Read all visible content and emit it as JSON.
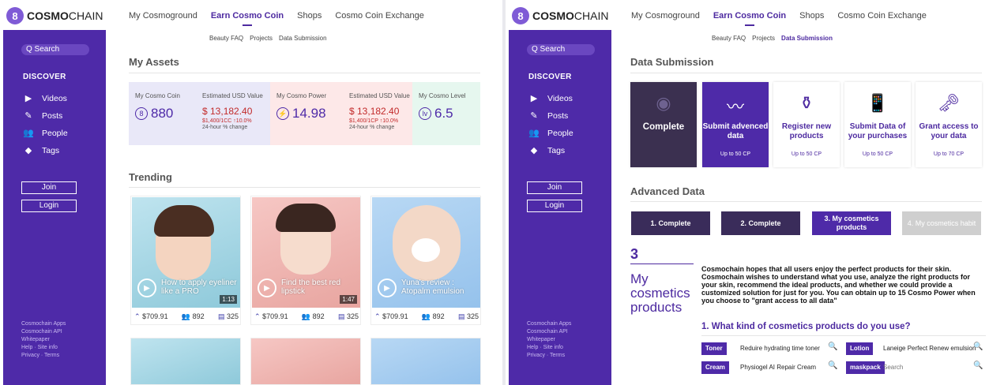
{
  "brand": {
    "logo_part1": "COSMO",
    "logo_part2": "CHAIN",
    "logo_mark": "8"
  },
  "nav": [
    "My Cosmoground",
    "Earn Cosmo Coin",
    "Shops",
    "Cosmo Coin Exchange"
  ],
  "subnav": [
    "Beauty FAQ",
    "Projects",
    "Data Submission"
  ],
  "sidebar": {
    "search": "Q  Search",
    "discover": "DISCOVER",
    "items": [
      {
        "label": "Videos",
        "icon": "video-icon"
      },
      {
        "label": "Posts",
        "icon": "pen-icon"
      },
      {
        "label": "People",
        "icon": "people-icon"
      },
      {
        "label": "Tags",
        "icon": "tag-icon"
      }
    ],
    "join": "Join",
    "login": "Login",
    "footer": [
      "Cosmochain Apps",
      "Cosmochain API",
      "Whitepaper",
      "Help · Site info",
      "Privacy · Terms"
    ]
  },
  "assets": {
    "title": "My Assets",
    "coin_label": "My Cosmo Coin",
    "coin_value": "880",
    "usd_label": "Estimated USD Value",
    "usd_value": "$ 13,182.40",
    "rate1": "$1,400/1CC  ↑10.0%",
    "change": "24-hour % change",
    "power_label": "My Cosmo Power",
    "power_value": "14.98",
    "usd2_label": "Estimated USD Value",
    "usd2_value": "$ 13,182.40",
    "rate2": "$1,400/1CP  ↑10.0%",
    "change2": "24-hour % change",
    "level_label": "My Cosmo Level",
    "level_value": "6.5"
  },
  "trending": {
    "title": "Trending",
    "cards": [
      {
        "title": "How to apply eyeliner like a PRO",
        "duration": "1:13",
        "coin": "$709.91",
        "people": "892",
        "comments": "325"
      },
      {
        "title": "Find the best red lipstick",
        "duration": "1:47",
        "coin": "$709.91",
        "people": "892",
        "comments": "325"
      },
      {
        "title": "Yuna's review : Atopalm emulsion",
        "duration": "",
        "coin": "$709.91",
        "people": "892",
        "comments": "325"
      }
    ]
  },
  "data_submission": {
    "title": "Data Submission",
    "cards": [
      {
        "title": "Complete",
        "cp": ""
      },
      {
        "title": "Submit advenced data",
        "cp": "Up to 50 CP"
      },
      {
        "title": "Register new products",
        "cp": "Up to 50 CP"
      },
      {
        "title": "Submit Data of your purchases",
        "cp": "Up to 50 CP"
      },
      {
        "title": "Grant access to your data",
        "cp": "Up to 70 CP"
      }
    ]
  },
  "advanced": {
    "title": "Advanced Data",
    "steps": [
      "1. Complete",
      "2. Complete",
      "3. My cosmetics products",
      "4. My cosmetics habit"
    ],
    "number": "3",
    "heading": "My cosmetics products",
    "paragraph": "Cosmochain hopes that all users enjoy the perfect products for their skin. Cosmochain wishes to understand what you use, analyze the right products for your skin, recommend the ideal products, and whether we could provide a customized solution for just for you. You can obtain up to 15 Cosmo Power when you choose to \"grant access to all data\"",
    "question": "1. What kind of cosmetics products do you use?",
    "fields": [
      {
        "tag": "Toner",
        "value": "Reduire hydrating time toner"
      },
      {
        "tag": "Lotion",
        "value": "Laneige Perfect Renew emulsion"
      },
      {
        "tag": "Cream",
        "value": "Physiogel AI Repair Cream"
      },
      {
        "tag": "maskpack",
        "value": "",
        "placeholder": "Search"
      }
    ]
  },
  "colors": {
    "primary": "#4e2aa8",
    "accent": "#7f5bd6",
    "red": "#c22a2a"
  }
}
